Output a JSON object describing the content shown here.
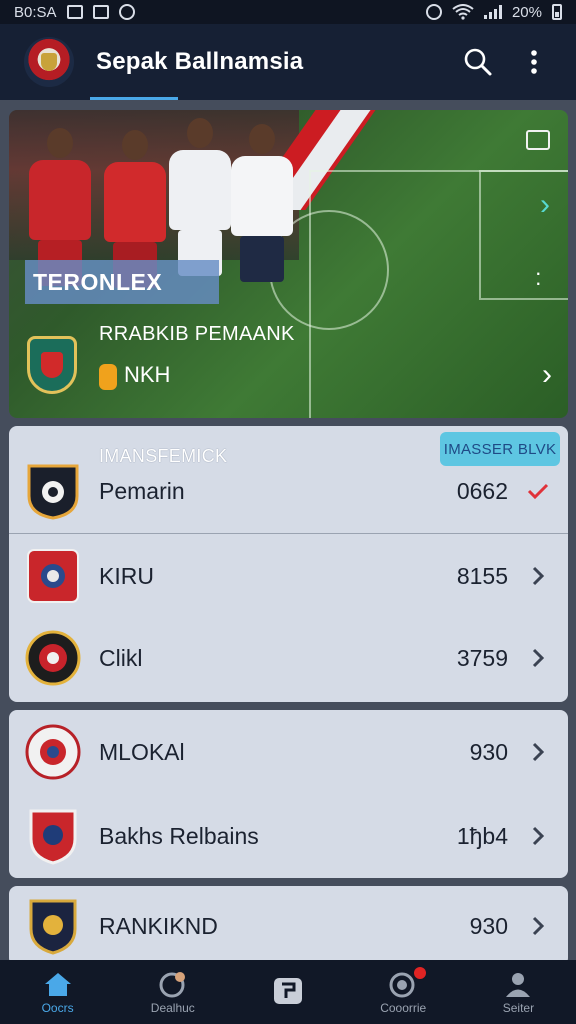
{
  "status_bar": {
    "time": "B0:SA",
    "battery": "20%"
  },
  "app_bar": {
    "title": "Sepak Ballnamsia",
    "search_icon": "search-icon",
    "menu_icon": "more-vert-icon"
  },
  "hero": {
    "tag": "TERONLEX",
    "subtitle": "RRABKIB PEMAANK",
    "chip_label": "NKH"
  },
  "card1": {
    "caption": "IMANSFEMICK",
    "action_label": "IMASSER BLVK",
    "rows": [
      {
        "name": "Pemarin",
        "value": "0662"
      },
      {
        "name": "KIRU",
        "value": "8155"
      },
      {
        "name": "Clikl",
        "value": "3759"
      }
    ]
  },
  "card2": {
    "rows": [
      {
        "name": "MLOKAl",
        "value": "930"
      },
      {
        "name": "Bakhs Relbains",
        "value": "1ђb4"
      }
    ]
  },
  "card3": {
    "rows": [
      {
        "name": "RANKIKND",
        "value": "930"
      }
    ]
  },
  "bottom_nav": [
    {
      "label": "Oocrs",
      "icon": "home-icon",
      "active": true
    },
    {
      "label": "Dealhuc",
      "icon": "ball-icon",
      "active": false
    },
    {
      "label": "",
      "icon": "grid-icon",
      "active": false
    },
    {
      "label": "Cooorrie",
      "icon": "record-icon",
      "active": false
    },
    {
      "label": "Seiter",
      "icon": "profile-icon",
      "active": false
    }
  ],
  "colors": {
    "accent": "#4aa8e8",
    "app_bar": "#162034",
    "card": "#d5dbe6",
    "alert": "#e02424"
  }
}
